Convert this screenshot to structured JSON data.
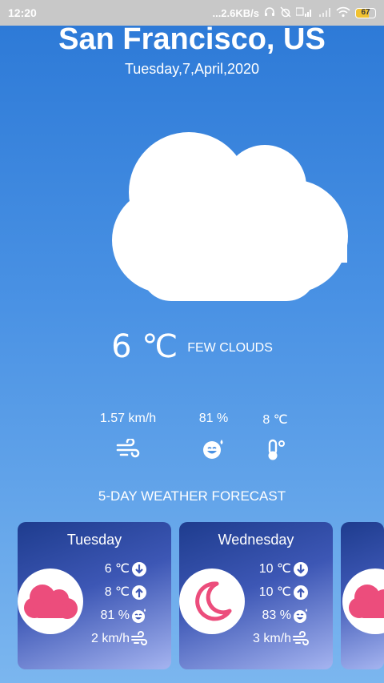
{
  "status_bar": {
    "time": "12:20",
    "network_speed": "...2.6KB/s",
    "battery": "67"
  },
  "location": {
    "city": "San Francisco, US",
    "date": "Tuesday,7,April,2020"
  },
  "current": {
    "icon": "cloud-icon",
    "temperature": "6 ℃",
    "condition": "FEW CLOUDS",
    "wind": "1.57 km/h",
    "humidity": "81 %",
    "feels_like": "8 ℃"
  },
  "forecast_title": "5-DAY WEATHER FORECAST",
  "forecast": [
    {
      "day": "Tuesday",
      "icon": "cloud-icon",
      "min": "6 ℃",
      "max": "8 ℃",
      "humidity": "81 %",
      "wind": "2 km/h"
    },
    {
      "day": "Wednesday",
      "icon": "moon-icon",
      "min": "10 ℃",
      "max": "10 ℃",
      "humidity": "83 %",
      "wind": "3 km/h"
    }
  ],
  "colors": {
    "accent_pink": "#ec4d7c",
    "sky_top": "#2b78d6",
    "sky_bottom": "#7bb6ef"
  }
}
